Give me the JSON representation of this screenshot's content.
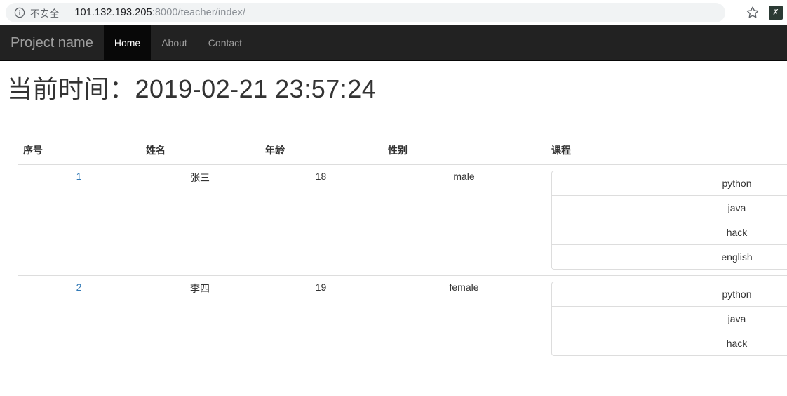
{
  "browser": {
    "security_label": "不安全",
    "security_icon": "info-circle-icon",
    "url_host": "101.132.193.205",
    "url_rest": ":8000/teacher/index/",
    "star_icon": "star-icon",
    "extension_icon": "extension-icon",
    "extension_glyph": "✗"
  },
  "navbar": {
    "brand": "Project name",
    "items": [
      {
        "label": "Home",
        "active": true
      },
      {
        "label": "About",
        "active": false
      },
      {
        "label": "Contact",
        "active": false
      }
    ]
  },
  "page": {
    "title": "当前时间：2019-02-21 23:57:24",
    "title_prefix": "当前时间：",
    "current_time": "2019-02-21 23:57:24"
  },
  "table": {
    "headers": [
      "序号",
      "姓名",
      "年龄",
      "性别",
      "课程"
    ],
    "rows": [
      {
        "id": "1",
        "name": "张三",
        "age": "18",
        "gender": "male",
        "courses": [
          "python",
          "java",
          "hack",
          "english"
        ]
      },
      {
        "id": "2",
        "name": "李四",
        "age": "19",
        "gender": "female",
        "courses": [
          "python",
          "java",
          "hack"
        ]
      }
    ]
  },
  "colors": {
    "navbar_bg": "#222222",
    "navbar_active_bg": "#080808",
    "link": "#337ab7",
    "text": "#333333",
    "border": "#dddddd",
    "omnibox_bg": "#f1f3f4"
  }
}
